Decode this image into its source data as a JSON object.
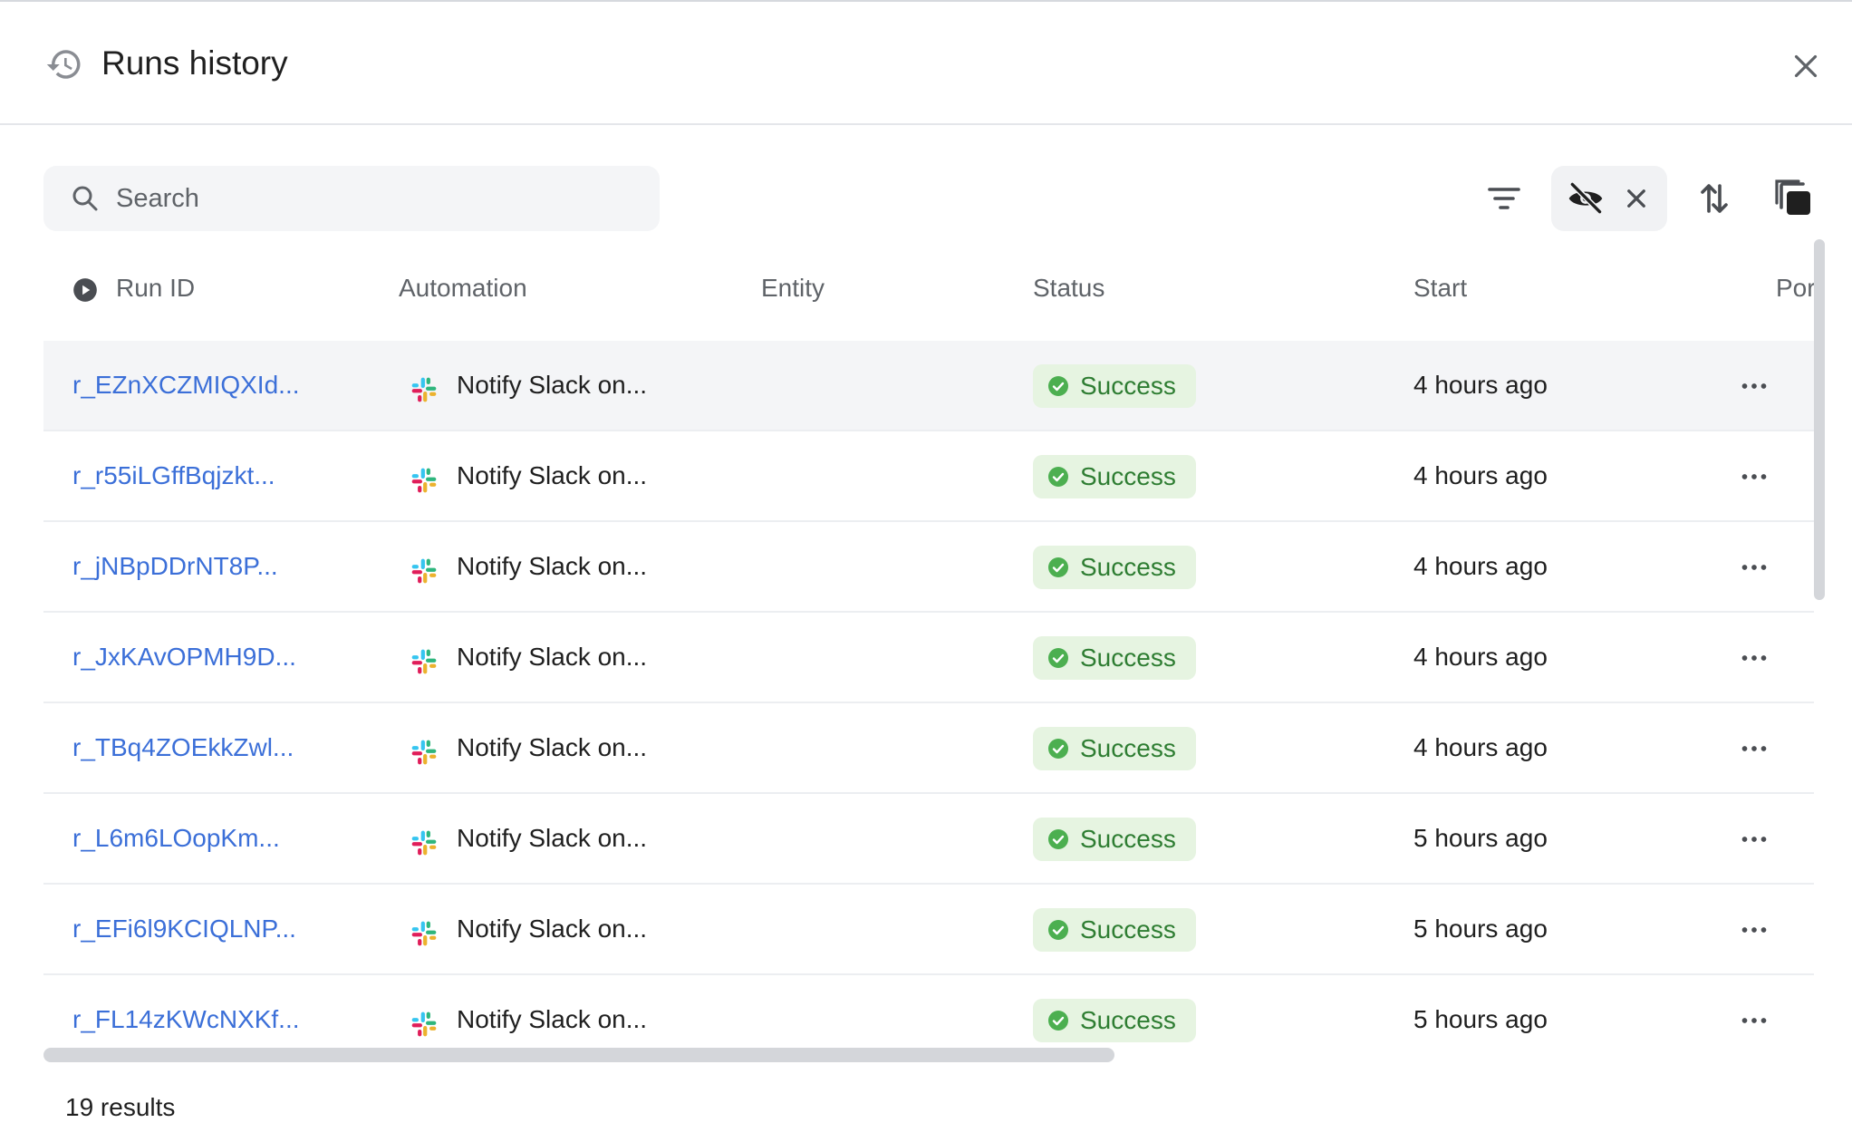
{
  "header": {
    "title": "Runs history",
    "icon": "history-icon",
    "close_icon": "close-icon"
  },
  "toolbar": {
    "search_placeholder": "Search",
    "search_value": "",
    "filter_icon": "filter-icon",
    "hidden_toggle_icon": "eye-off-icon",
    "hidden_clear_icon": "close-icon",
    "sort_icon": "sort-icon",
    "copy_icon": "copy-icon"
  },
  "table": {
    "columns": [
      {
        "key": "run_id",
        "label": "Run ID"
      },
      {
        "key": "automation",
        "label": "Automation"
      },
      {
        "key": "entity",
        "label": "Entity"
      },
      {
        "key": "status",
        "label": "Status"
      },
      {
        "key": "start",
        "label": "Start"
      },
      {
        "key": "port",
        "label": "Por"
      }
    ],
    "rows": [
      {
        "run_id": "r_EZnXCZMIQXId...",
        "automation": "Notify Slack on...",
        "entity": "",
        "status": "Success",
        "start": "4 hours ago"
      },
      {
        "run_id": "r_r55iLGffBqjzkt...",
        "automation": "Notify Slack on...",
        "entity": "",
        "status": "Success",
        "start": "4 hours ago"
      },
      {
        "run_id": "r_jNBpDDrNT8P...",
        "automation": "Notify Slack on...",
        "entity": "",
        "status": "Success",
        "start": "4 hours ago"
      },
      {
        "run_id": "r_JxKAvOPMH9D...",
        "automation": "Notify Slack on...",
        "entity": "",
        "status": "Success",
        "start": "4 hours ago"
      },
      {
        "run_id": "r_TBq4ZOEkkZwl...",
        "automation": "Notify Slack on...",
        "entity": "",
        "status": "Success",
        "start": "4 hours ago"
      },
      {
        "run_id": "r_L6m6LOopKm...",
        "automation": "Notify Slack on...",
        "entity": "",
        "status": "Success",
        "start": "5 hours ago"
      },
      {
        "run_id": "r_EFi6l9KCIQLNP...",
        "automation": "Notify Slack on...",
        "entity": "",
        "status": "Success",
        "start": "5 hours ago"
      },
      {
        "run_id": "r_FL14zKWcNXKf...",
        "automation": "Notify Slack on...",
        "entity": "",
        "status": "Success",
        "start": "5 hours ago"
      }
    ],
    "row_icons": {
      "automation": "slack-icon",
      "status": "check-circle-icon",
      "actions": "more-horizontal-icon"
    }
  },
  "footer": {
    "results_label": "19 results"
  },
  "colors": {
    "link": "#3b6fd8",
    "success_bg": "#e6f4e1",
    "success_text": "#2e7d32",
    "success_icon": "#4caf50",
    "row_hover": "#f4f5f7"
  }
}
